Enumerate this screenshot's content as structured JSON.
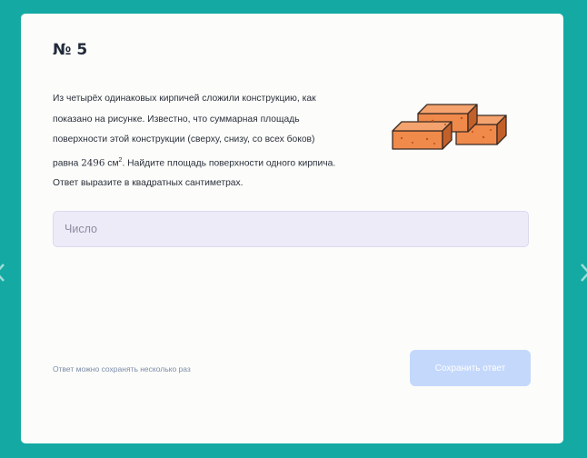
{
  "task": {
    "number": "№ 5",
    "problem_lines": {
      "l1": "Из четырёх одинаковых кирпичей сложили конструкцию, как",
      "l2": "показано на рисунке. Известно, что суммарная площадь",
      "l3": "поверхности этой конструкции (сверху, снизу, со всех боков)",
      "l4_prefix": "равна ",
      "l4_number": "2496",
      "l4_unit": "см",
      "l4_exponent": "2",
      "l4_suffix": ". Найдите площадь поверхности одного кирпича.",
      "l5": "Ответ выразите в квадратных сантиметрах."
    },
    "figure_icon": "bricks-illustration"
  },
  "answer": {
    "placeholder": "Число",
    "value": ""
  },
  "footer": {
    "hint": "Ответ можно сохранять несколько раз",
    "save_label": "Сохранить ответ"
  },
  "nav": {
    "prev_icon": "chevron-left-icon",
    "next_icon": "chevron-right-icon"
  },
  "colors": {
    "background": "#14a9a3",
    "card": "#fcfdfa",
    "input_bg": "#eeebf9",
    "button_bg": "#c4d8fb",
    "brick": "#f08a4b"
  }
}
